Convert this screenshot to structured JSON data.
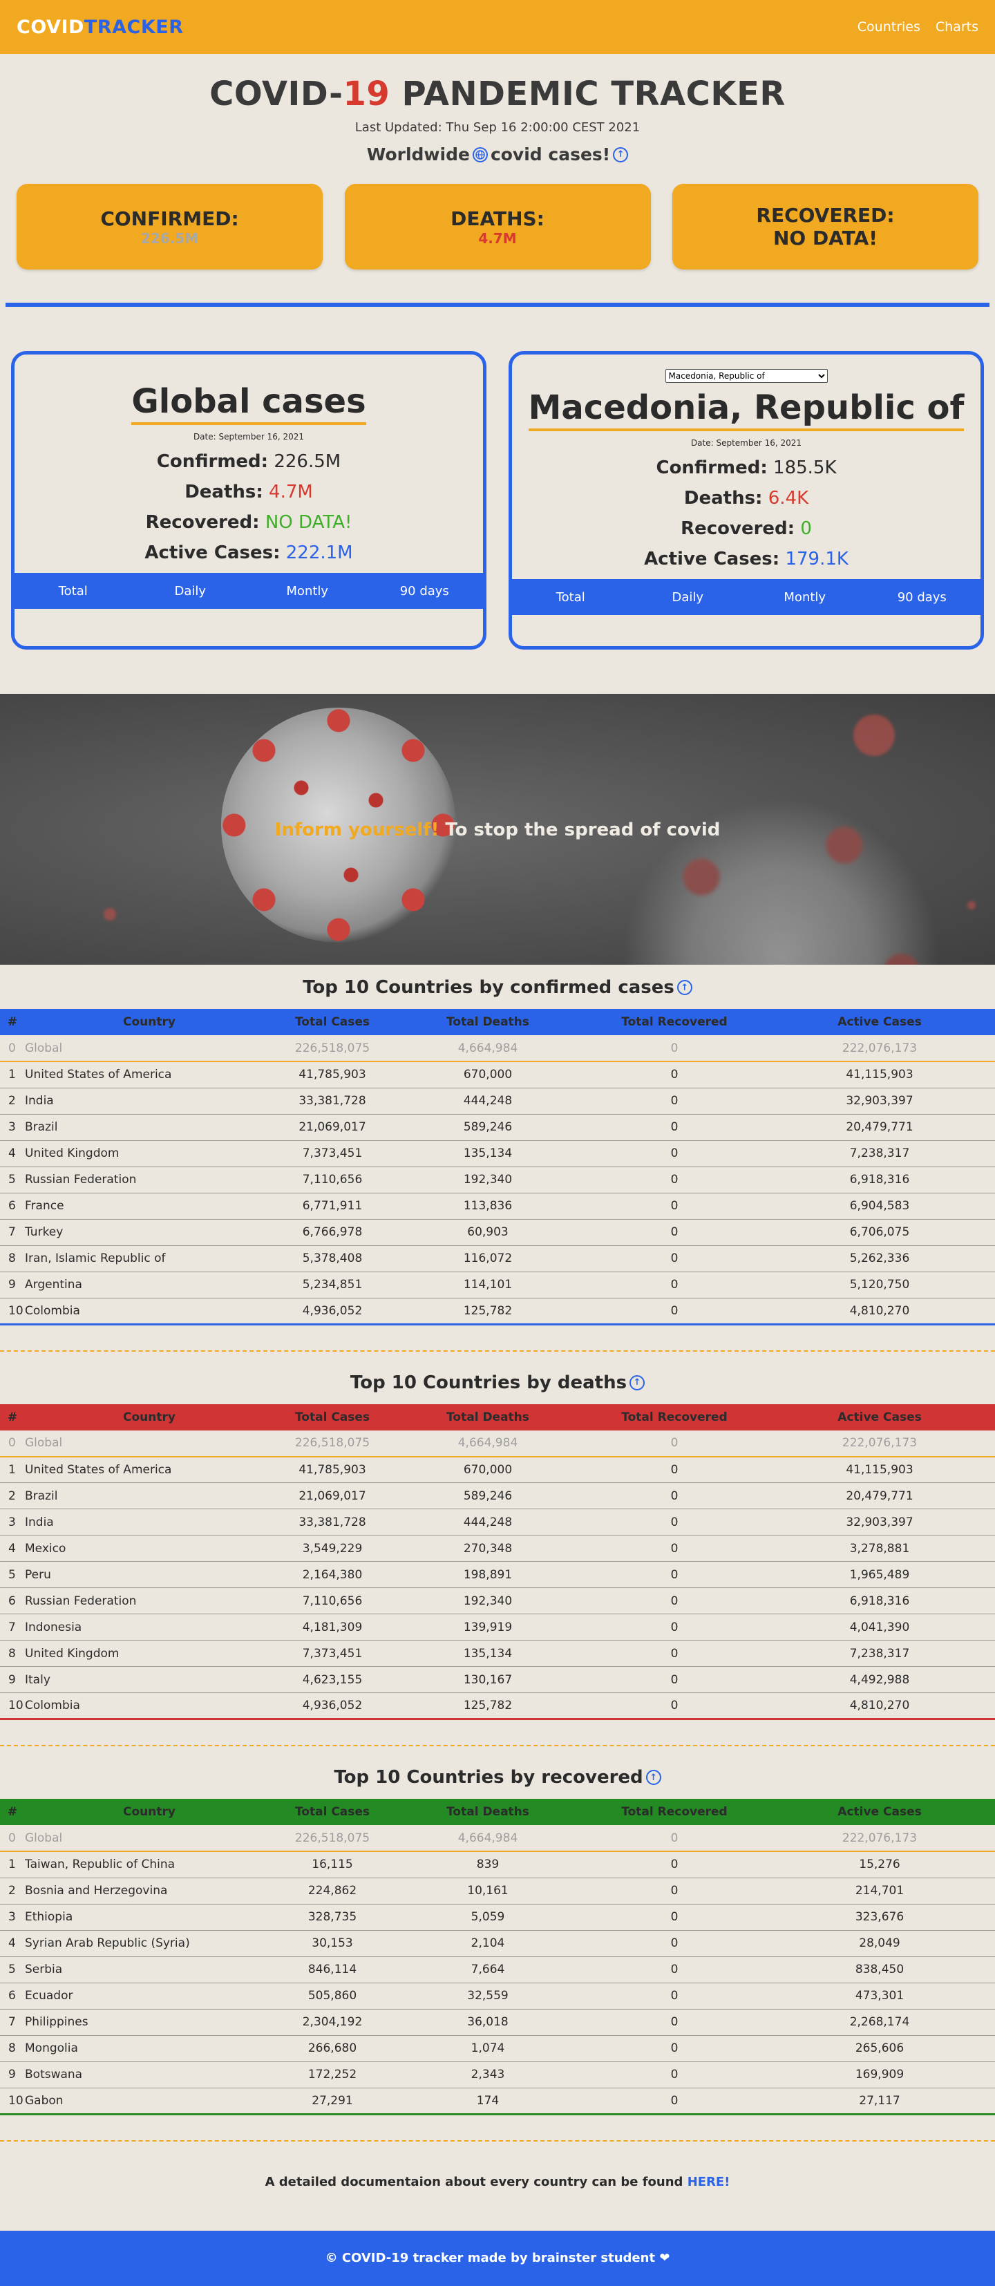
{
  "navbar": {
    "brand_part1": "COVID",
    "brand_part2": "TRACKER",
    "links": [
      "Countries",
      "Charts"
    ]
  },
  "hero": {
    "title_part1": "COVID-",
    "title_part2": "19",
    "title_part3": " PANDEMIC TRACKER",
    "last_updated": "Last Updated: Thu Sep 16 2:00:00 CEST 2021",
    "worldwide_prefix": "Worldwide",
    "worldwide_suffix": "covid cases!",
    "cards": {
      "confirmed_label": "CONFIRMED:",
      "confirmed_value": "226.5M",
      "deaths_label": "DEATHS:",
      "deaths_value": "4.7M",
      "recovered_label": "RECOVERED:",
      "recovered_value": "NO DATA!"
    }
  },
  "global_panel": {
    "title": "Global cases",
    "date": "Date: September 16, 2021",
    "confirmed_label": "Confirmed:",
    "confirmed_value": "226.5M",
    "deaths_label": "Deaths:",
    "deaths_value": "4.7M",
    "recovered_label": "Recovered:",
    "recovered_value": "NO DATA!",
    "active_label": "Active Cases:",
    "active_value": "222.1M",
    "tabs": [
      "Total",
      "Daily",
      "Montly",
      "90 days"
    ]
  },
  "country_panel": {
    "select_value": "Macedonia, Republic of",
    "title": "Macedonia, Republic of",
    "date": "Date: September 16, 2021",
    "confirmed_label": "Confirmed:",
    "confirmed_value": "185.5K",
    "deaths_label": "Deaths:",
    "deaths_value": "6.4K",
    "recovered_label": "Recovered:",
    "recovered_value": "0",
    "active_label": "Active Cases:",
    "active_value": "179.1K",
    "tabs": [
      "Total",
      "Daily",
      "Montly",
      "90 days"
    ]
  },
  "banner": {
    "highlight": "Inform yourself!",
    "text": " To stop the spread of covid"
  },
  "tables": [
    {
      "title": "Top 10 Countries by confirmed cases",
      "header_color": "#2a63e8",
      "bottom_color": "#2a63e8",
      "columns": [
        "#",
        "Country",
        "Total Cases",
        "Total Deaths",
        "Total Recovered",
        "Active Cases"
      ],
      "rows": [
        [
          "0",
          "Global",
          "226,518,075",
          "4,664,984",
          "0",
          "222,076,173"
        ],
        [
          "1",
          "United States of America",
          "41,785,903",
          "670,000",
          "0",
          "41,115,903"
        ],
        [
          "2",
          "India",
          "33,381,728",
          "444,248",
          "0",
          "32,903,397"
        ],
        [
          "3",
          "Brazil",
          "21,069,017",
          "589,246",
          "0",
          "20,479,771"
        ],
        [
          "4",
          "United Kingdom",
          "7,373,451",
          "135,134",
          "0",
          "7,238,317"
        ],
        [
          "5",
          "Russian Federation",
          "7,110,656",
          "192,340",
          "0",
          "6,918,316"
        ],
        [
          "6",
          "France",
          "6,771,911",
          "113,836",
          "0",
          "6,904,583"
        ],
        [
          "7",
          "Turkey",
          "6,766,978",
          "60,903",
          "0",
          "6,706,075"
        ],
        [
          "8",
          "Iran, Islamic Republic of",
          "5,378,408",
          "116,072",
          "0",
          "5,262,336"
        ],
        [
          "9",
          "Argentina",
          "5,234,851",
          "114,101",
          "0",
          "5,120,750"
        ],
        [
          "10",
          "Colombia",
          "4,936,052",
          "125,782",
          "0",
          "4,810,270"
        ]
      ]
    },
    {
      "title": "Top 10 Countries by deaths",
      "header_color": "#d03434",
      "bottom_color": "#d03434",
      "columns": [
        "#",
        "Country",
        "Total Cases",
        "Total Deaths",
        "Total Recovered",
        "Active Cases"
      ],
      "rows": [
        [
          "0",
          "Global",
          "226,518,075",
          "4,664,984",
          "0",
          "222,076,173"
        ],
        [
          "1",
          "United States of America",
          "41,785,903",
          "670,000",
          "0",
          "41,115,903"
        ],
        [
          "2",
          "Brazil",
          "21,069,017",
          "589,246",
          "0",
          "20,479,771"
        ],
        [
          "3",
          "India",
          "33,381,728",
          "444,248",
          "0",
          "32,903,397"
        ],
        [
          "4",
          "Mexico",
          "3,549,229",
          "270,348",
          "0",
          "3,278,881"
        ],
        [
          "5",
          "Peru",
          "2,164,380",
          "198,891",
          "0",
          "1,965,489"
        ],
        [
          "6",
          "Russian Federation",
          "7,110,656",
          "192,340",
          "0",
          "6,918,316"
        ],
        [
          "7",
          "Indonesia",
          "4,181,309",
          "139,919",
          "0",
          "4,041,390"
        ],
        [
          "8",
          "United Kingdom",
          "7,373,451",
          "135,134",
          "0",
          "7,238,317"
        ],
        [
          "9",
          "Italy",
          "4,623,155",
          "130,167",
          "0",
          "4,492,988"
        ],
        [
          "10",
          "Colombia",
          "4,936,052",
          "125,782",
          "0",
          "4,810,270"
        ]
      ]
    },
    {
      "title": "Top 10 Countries by recovered",
      "header_color": "#248a24",
      "bottom_color": "#248a24",
      "columns": [
        "#",
        "Country",
        "Total Cases",
        "Total Deaths",
        "Total Recovered",
        "Active Cases"
      ],
      "rows": [
        [
          "0",
          "Global",
          "226,518,075",
          "4,664,984",
          "0",
          "222,076,173"
        ],
        [
          "1",
          "Taiwan, Republic of China",
          "16,115",
          "839",
          "0",
          "15,276"
        ],
        [
          "2",
          "Bosnia and Herzegovina",
          "224,862",
          "10,161",
          "0",
          "214,701"
        ],
        [
          "3",
          "Ethiopia",
          "328,735",
          "5,059",
          "0",
          "323,676"
        ],
        [
          "4",
          "Syrian Arab Republic (Syria)",
          "30,153",
          "2,104",
          "0",
          "28,049"
        ],
        [
          "5",
          "Serbia",
          "846,114",
          "7,664",
          "0",
          "838,450"
        ],
        [
          "6",
          "Ecuador",
          "505,860",
          "32,559",
          "0",
          "473,301"
        ],
        [
          "7",
          "Philippines",
          "2,304,192",
          "36,018",
          "0",
          "2,268,174"
        ],
        [
          "8",
          "Mongolia",
          "266,680",
          "1,074",
          "0",
          "265,606"
        ],
        [
          "9",
          "Botswana",
          "172,252",
          "2,343",
          "0",
          "169,909"
        ],
        [
          "10",
          "Gabon",
          "27,291",
          "174",
          "0",
          "27,117"
        ]
      ]
    }
  ],
  "footer_note": {
    "text": "A detailed documentaion about every country can be found ",
    "link": "HERE!"
  },
  "footer": {
    "text": "© COVID-19 tracker made by brainster student ❤"
  }
}
